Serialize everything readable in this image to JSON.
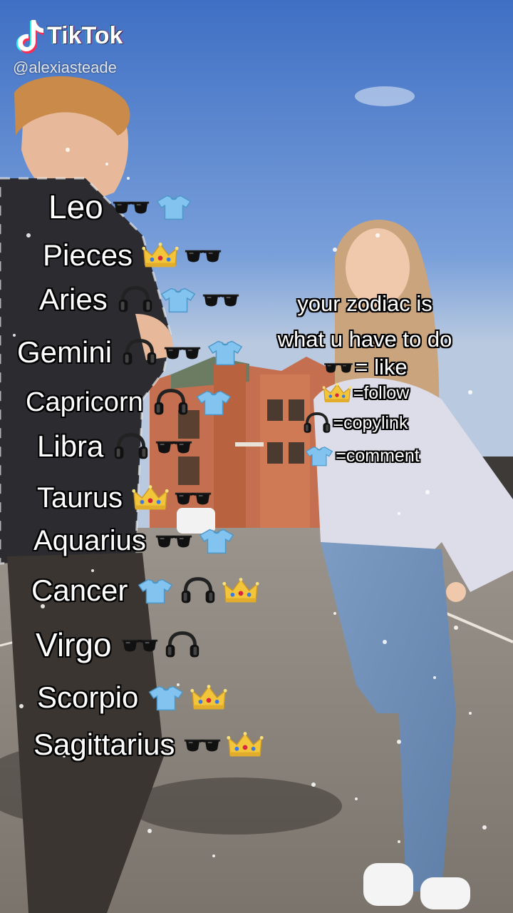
{
  "watermark": {
    "brand": "TikTok",
    "username": "@alexiasteade",
    "icon": "tiktok-note-icon"
  },
  "zodiac_list": [
    {
      "sign": "Leo",
      "icons": [
        "sunglasses",
        "tshirt"
      ]
    },
    {
      "sign": "Pieces",
      "icons": [
        "crown",
        "sunglasses"
      ]
    },
    {
      "sign": "Aries",
      "icons": [
        "headphones",
        "tshirt",
        "sunglasses"
      ]
    },
    {
      "sign": "Gemini",
      "icons": [
        "headphones",
        "sunglasses",
        "tshirt"
      ]
    },
    {
      "sign": "Capricorn",
      "icons": [
        "headphones",
        "tshirt"
      ]
    },
    {
      "sign": "Libra",
      "icons": [
        "headphones",
        "sunglasses"
      ]
    },
    {
      "sign": "Taurus",
      "icons": [
        "crown",
        "sunglasses"
      ]
    },
    {
      "sign": "Aquarius",
      "icons": [
        "sunglasses",
        "tshirt"
      ]
    },
    {
      "sign": "Cancer",
      "icons": [
        "tshirt",
        "headphones",
        "crown"
      ]
    },
    {
      "sign": "Virgo",
      "icons": [
        "sunglasses",
        "headphones"
      ]
    },
    {
      "sign": "Scorpio",
      "icons": [
        "tshirt",
        "crown"
      ]
    },
    {
      "sign": "Sagittarius",
      "icons": [
        "sunglasses",
        "crown"
      ]
    }
  ],
  "legend": {
    "line1": "your zodiac is",
    "line2": "what u have to do",
    "items": [
      {
        "icon": "sunglasses",
        "text": "= like"
      },
      {
        "icon": "crown",
        "text": "=follow"
      },
      {
        "icon": "headphones",
        "text": "=copylink"
      },
      {
        "icon": "tshirt",
        "text": "=comment"
      }
    ]
  },
  "colors": {
    "sky": "#5f83c9",
    "text": "#ffffff",
    "outline": "#000000",
    "tshirt": "#7fc3ee",
    "crown": "#f2c53a"
  }
}
